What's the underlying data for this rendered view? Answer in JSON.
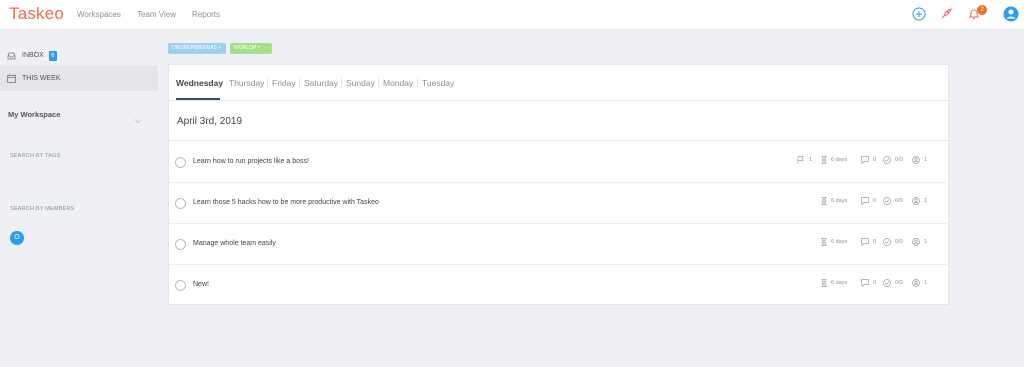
{
  "app": {
    "logo": "Taskeo",
    "nav": [
      "Workspaces",
      "Team View",
      "Reports"
    ],
    "notification_count": "2",
    "colors": {
      "brand": "#f26b4f",
      "accent": "#2d9cf0",
      "active_tab": "#3b4a6b"
    }
  },
  "sidebar": {
    "inbox": {
      "label": "INBOX",
      "count": "6"
    },
    "this_week": {
      "label": "THIS WEEK"
    },
    "workspace_title": "My Workspace",
    "search_by_tags": "SEARCH BY TAGS",
    "search_by_members": "SEARCH BY MEMBERS",
    "member_initial": "O"
  },
  "tags": [
    {
      "label": "ONLINEPIMEEMAS",
      "close": "×"
    },
    {
      "label": "WORLOP",
      "close": "×"
    }
  ],
  "tabs": [
    "Wednesday",
    "Thursday",
    "Friday",
    "Saturday",
    "Sunday",
    "Monday",
    "Tuesday"
  ],
  "active_tab": 0,
  "date_heading": "April 3rd, 2019",
  "tasks": [
    {
      "title": "Learn how to run projects like a boss!",
      "flags": "1",
      "duration": "6 days",
      "comments": "0",
      "checklist": "0/0",
      "members": "1"
    },
    {
      "title": "Learn those 5 hacks how to be more productive with Taskeo",
      "duration": "6 days",
      "comments": "0",
      "checklist": "0/0",
      "members": "1"
    },
    {
      "title": "Manage whole team easily",
      "duration": "6 days",
      "comments": "0",
      "checklist": "0/0",
      "members": "1"
    },
    {
      "title": "New!",
      "duration": "6 days",
      "comments": "0",
      "checklist": "0/0",
      "members": "1"
    }
  ],
  "icons": [
    "inbox-icon",
    "calendar-icon",
    "chevron-down-icon",
    "add-icon",
    "rocket-icon",
    "bell-icon",
    "user-avatar-icon",
    "flag-icon",
    "hourglass-icon",
    "comment-icon",
    "checklist-icon",
    "member-icon"
  ]
}
